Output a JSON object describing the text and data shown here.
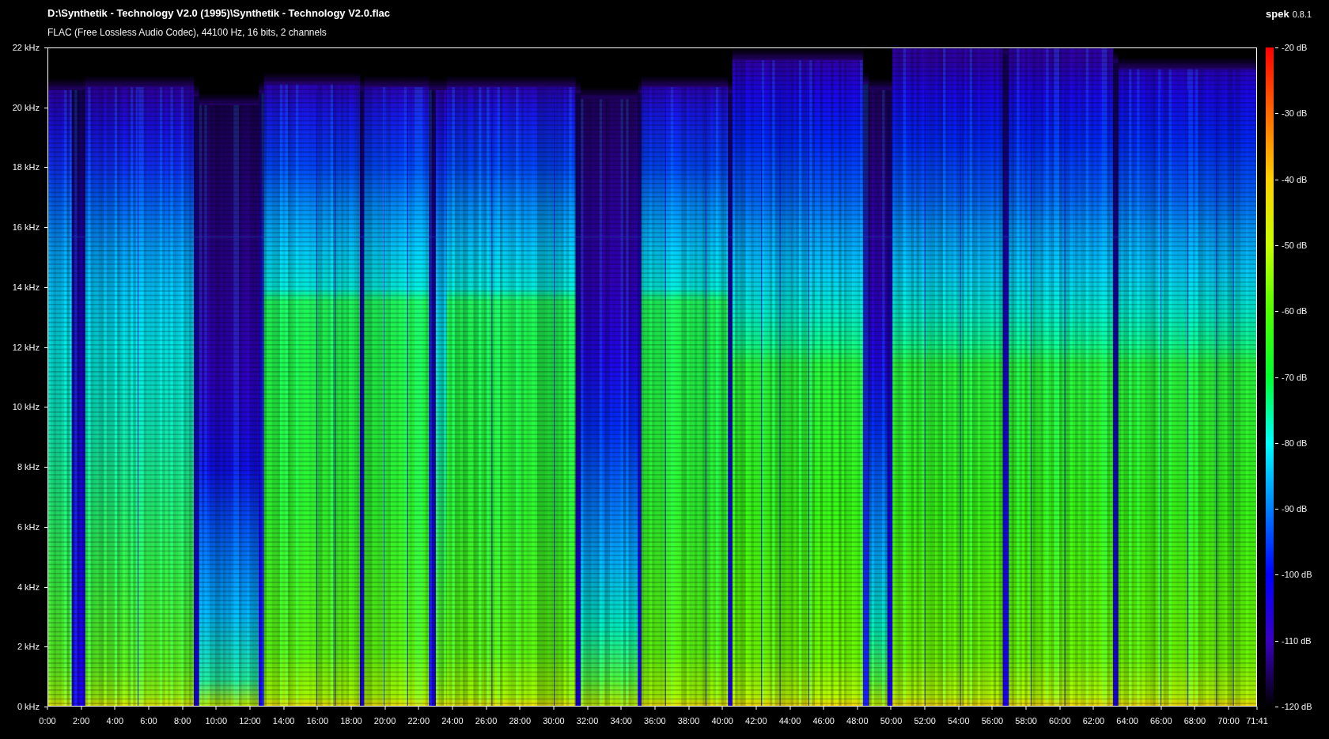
{
  "header": {
    "title": "D:\\Synthetik - Technology V2.0 (1995)\\Synthetik - Technology V2.0.flac",
    "subtitle": "FLAC (Free Lossless Audio Codec), 44100 Hz, 16 bits, 2 channels"
  },
  "brand": {
    "name": "spek",
    "version": "0.8.1"
  },
  "frequency_axis": {
    "labels": [
      "22 kHz",
      "20 kHz",
      "18 kHz",
      "16 kHz",
      "14 kHz",
      "12 kHz",
      "10 kHz",
      "8 kHz",
      "6 kHz",
      "4 kHz",
      "2 kHz",
      "0 kHz"
    ]
  },
  "time_axis": {
    "labels": [
      "0:00",
      "2:00",
      "4:00",
      "6:00",
      "8:00",
      "10:00",
      "12:00",
      "14:00",
      "16:00",
      "18:00",
      "20:00",
      "22:00",
      "24:00",
      "26:00",
      "28:00",
      "30:00",
      "32:00",
      "34:00",
      "36:00",
      "38:00",
      "40:00",
      "42:00",
      "44:00",
      "46:00",
      "48:00",
      "50:00",
      "52:00",
      "54:00",
      "56:00",
      "58:00",
      "60:00",
      "62:00",
      "64:00",
      "66:00",
      "68:00",
      "70:00",
      "71:41"
    ]
  },
  "level_scale": {
    "labels": [
      "-20 dB",
      "-30 dB",
      "-40 dB",
      "-50 dB",
      "-60 dB",
      "-70 dB",
      "-80 dB",
      "-90 dB",
      "-100 dB",
      "-110 dB",
      "-120 dB"
    ]
  }
}
